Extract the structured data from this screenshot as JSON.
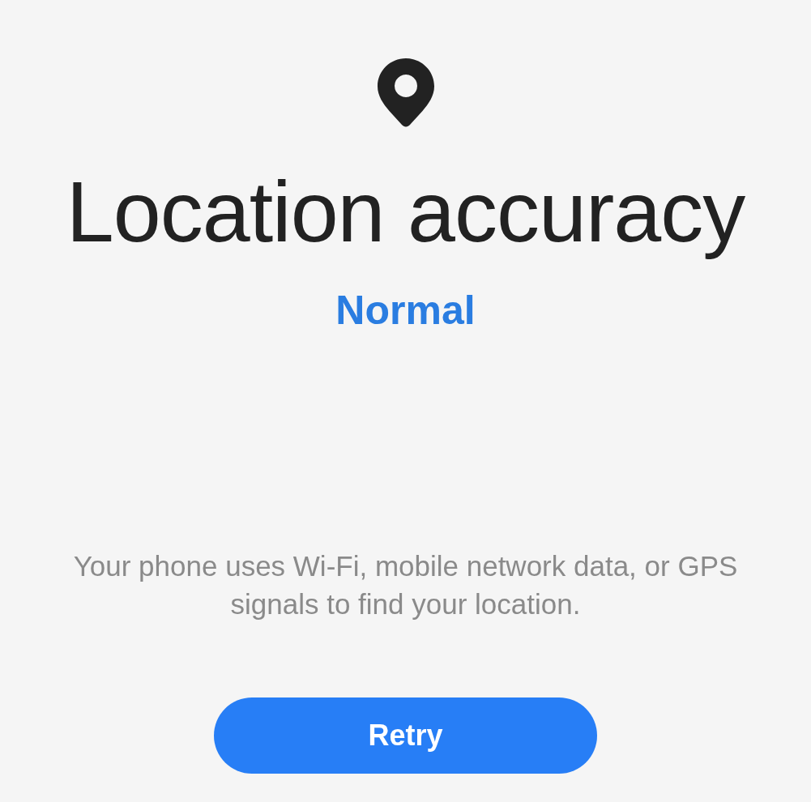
{
  "title": "Location accuracy",
  "mode": "Normal",
  "description": "Your phone uses Wi-Fi, mobile network data, or GPS signals to find your location.",
  "button": {
    "label": "Retry"
  }
}
